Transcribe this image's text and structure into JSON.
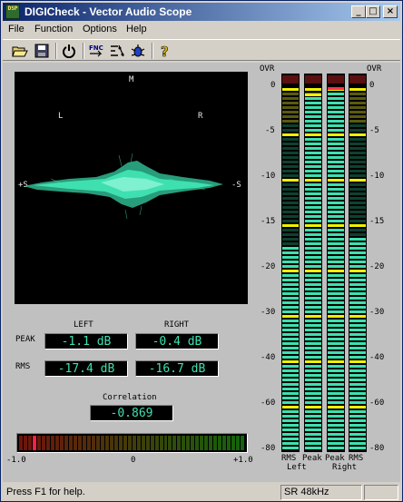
{
  "window": {
    "icon_text": "DSP",
    "title": "DIGICheck - Vector Audio Scope",
    "minimize": "_",
    "maximize": "□",
    "close": "×"
  },
  "menu": [
    "File",
    "Function",
    "Options",
    "Help"
  ],
  "toolbar": {
    "icons": [
      "open-icon",
      "save-icon",
      "power-icon",
      "fnc-icon",
      "bit-icon",
      "bug-icon",
      "help-icon"
    ],
    "fnc_label": "FNC"
  },
  "scope": {
    "top_label": "M",
    "left_label": "L",
    "right_label": "R",
    "plus_s": "+S",
    "minus_s": "-S",
    "trace_color": "#3fe0b0"
  },
  "levels": {
    "left_header": "LEFT",
    "right_header": "RIGHT",
    "peak_label": "PEAK",
    "rms_label": "RMS",
    "peak_left": "-1.1 dB",
    "peak_right": "-0.4 dB",
    "rms_left": "-17.4 dB",
    "rms_right": "-16.7 dB"
  },
  "correlation": {
    "label": "Correlation",
    "value": "-0.869",
    "value_num": -0.869,
    "scale_min": "-1.0",
    "scale_mid": "0",
    "scale_max": "+1.0"
  },
  "meters": {
    "ovr_left": "OVR",
    "ovr_right": "OVR",
    "scale": [
      "0",
      "-5",
      "-10",
      "-15",
      "-20",
      "-30",
      "-40",
      "-60",
      "-80"
    ],
    "columns": [
      {
        "label_top": "RMS",
        "label_bottom": "Left",
        "level_db": -17.4
      },
      {
        "label_top": "Peak",
        "label_bottom": "",
        "level_db": -1.1
      },
      {
        "label_top": "Peak",
        "label_bottom": "Right",
        "level_db": -0.4
      },
      {
        "label_top": "RMS",
        "label_bottom": "",
        "level_db": -16.7
      }
    ],
    "lit_color": "#3fe0b0",
    "marker_color": "#f0f000"
  },
  "status": {
    "help_text": "Press F1 for help.",
    "sample_rate": "SR 48kHz"
  }
}
